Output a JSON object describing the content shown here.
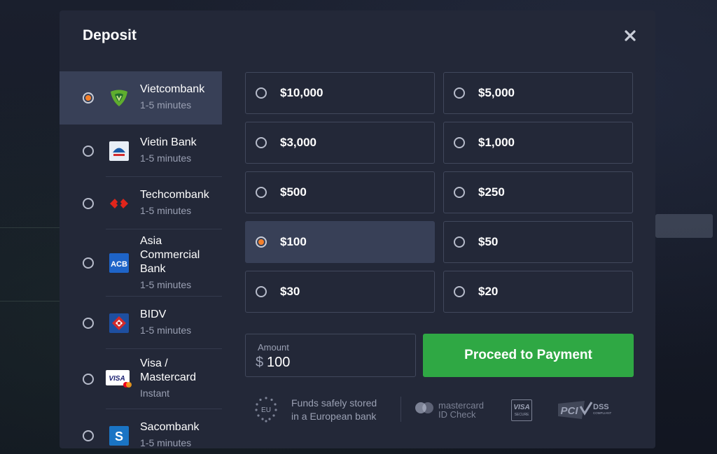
{
  "modal": {
    "title": "Deposit"
  },
  "banks": [
    {
      "name": "Vietcombank",
      "time": "1-5 minutes",
      "selected": true,
      "icon": "vietcombank-logo-icon"
    },
    {
      "name": "Vietin Bank",
      "time": "1-5 minutes",
      "selected": false,
      "icon": "vietinbank-logo-icon"
    },
    {
      "name": "Techcombank",
      "time": "1-5 minutes",
      "selected": false,
      "icon": "techcombank-logo-icon"
    },
    {
      "name": "Asia Commercial Bank",
      "name_lines": [
        "Asia",
        "Commercial",
        "Bank"
      ],
      "time": "1-5 minutes",
      "selected": false,
      "icon": "acb-logo-icon",
      "logo_text": "ACB"
    },
    {
      "name": "BIDV",
      "time": "1-5 minutes",
      "selected": false,
      "icon": "bidv-logo-icon"
    },
    {
      "name": "Visa / Mastercard",
      "name_lines": [
        "Visa /",
        "Mastercard"
      ],
      "time": "Instant",
      "selected": false,
      "icon": "visa-mastercard-logo-icon",
      "logo_text": "VISA"
    },
    {
      "name": "Sacombank",
      "time": "1-5 minutes",
      "selected": false,
      "icon": "sacombank-logo-icon",
      "logo_text": "S"
    }
  ],
  "amounts": [
    {
      "label": "$10,000",
      "selected": false
    },
    {
      "label": "$5,000",
      "selected": false
    },
    {
      "label": "$3,000",
      "selected": false
    },
    {
      "label": "$1,000",
      "selected": false
    },
    {
      "label": "$500",
      "selected": false
    },
    {
      "label": "$250",
      "selected": false
    },
    {
      "label": "$100",
      "selected": true
    },
    {
      "label": "$50",
      "selected": false
    },
    {
      "label": "$30",
      "selected": false
    },
    {
      "label": "$20",
      "selected": false
    }
  ],
  "amount_field": {
    "label": "Amount",
    "currency": "$",
    "value": "100"
  },
  "proceed_label": "Proceed to Payment",
  "footer": {
    "eu_label": "EU",
    "safe_line1": "Funds safely stored",
    "safe_line2": "in a European bank",
    "mc_line1": "mastercard",
    "mc_line2": "ID Check",
    "visa_line1": "VISA",
    "visa_line2": "SECURE",
    "pci_label": "PCI",
    "dss_label": "DSS",
    "dss_sub": "COMPLIANT"
  },
  "colors": {
    "accent_orange": "#f5802a",
    "proceed_green": "#2fa844",
    "modal_bg": "#232838",
    "selected_bg": "#384057"
  }
}
